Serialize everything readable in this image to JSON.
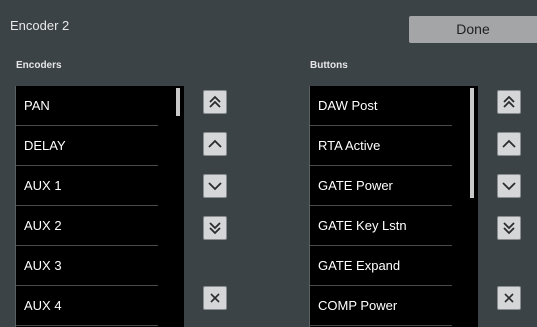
{
  "header": {
    "title": "Encoder 2",
    "done_label": "Done"
  },
  "encoders": {
    "label": "Encoders",
    "items": [
      "PAN",
      "DELAY",
      "AUX 1",
      "AUX 2",
      "AUX 3",
      "AUX 4"
    ]
  },
  "buttons": {
    "label": "Buttons",
    "items": [
      "DAW Post",
      "RTA Active",
      "GATE Power",
      "GATE Key Lstn",
      "GATE Expand",
      "COMP Power"
    ]
  },
  "controls": {
    "icons": [
      "double-chevron-up-icon",
      "chevron-up-icon",
      "chevron-down-icon",
      "double-chevron-down-icon",
      "close-icon"
    ]
  }
}
